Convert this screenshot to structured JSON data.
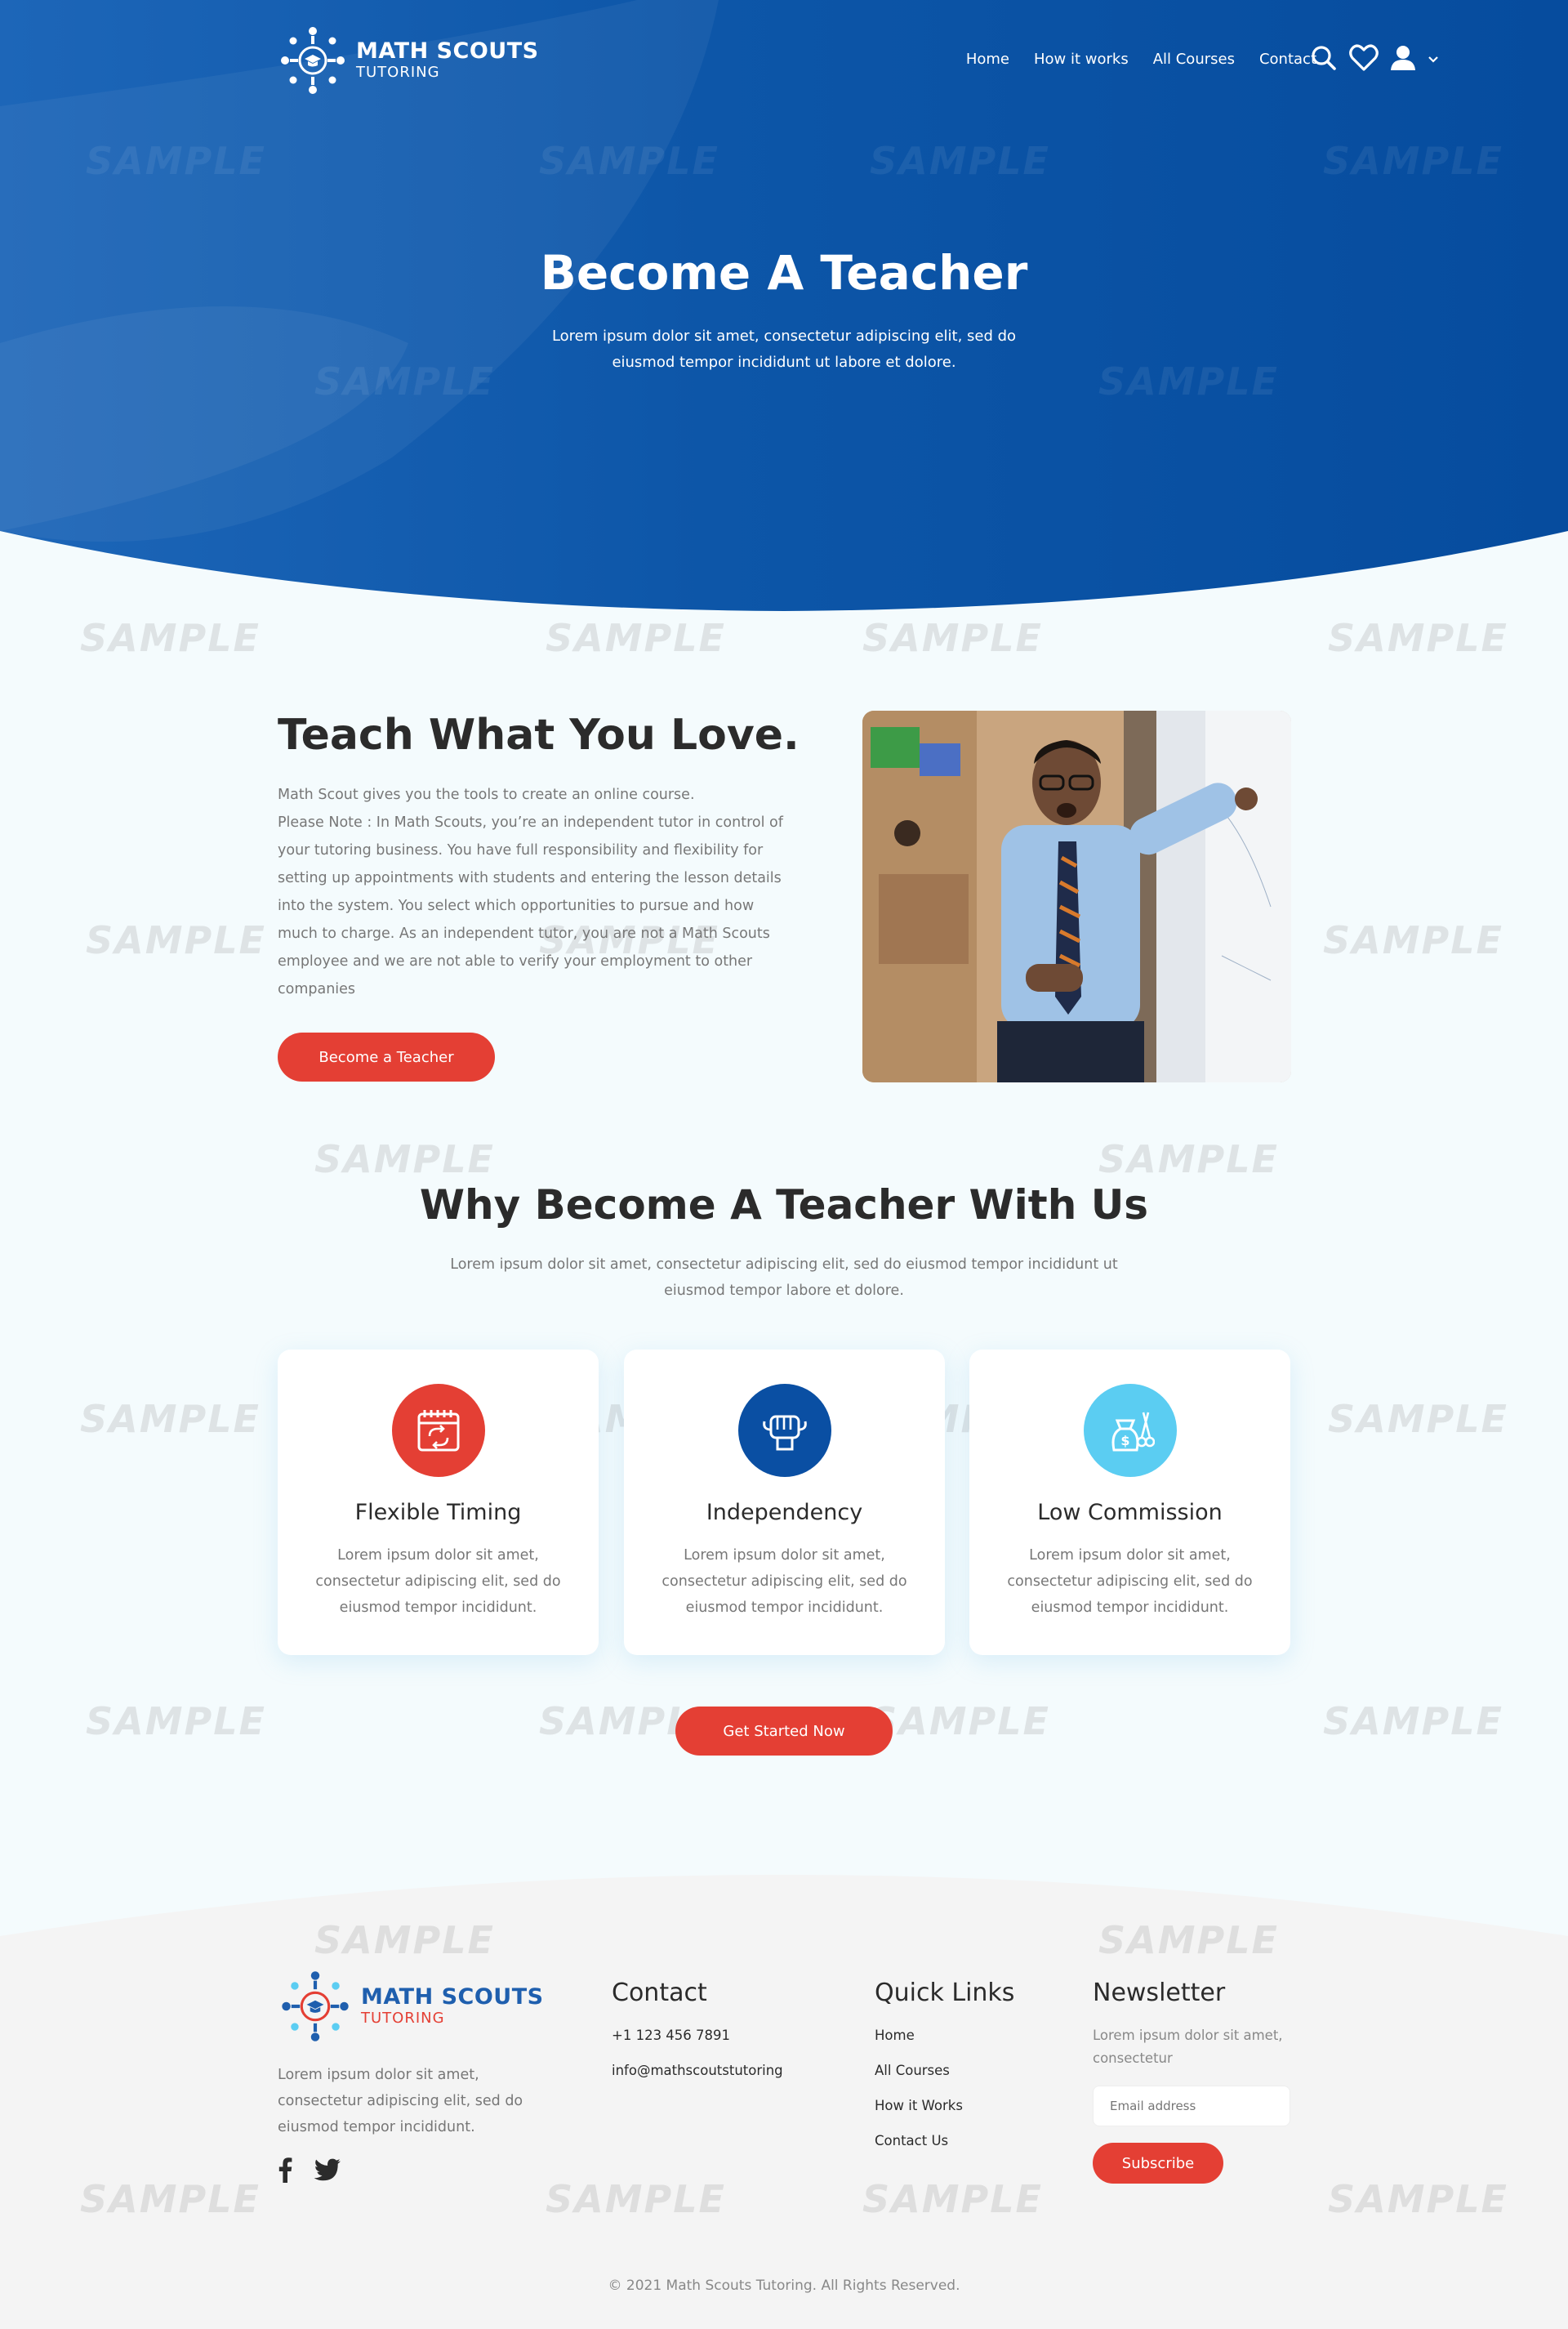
{
  "colors": {
    "primary_blue": "#0a4fa3",
    "hero_blue_light": "#2a74c4",
    "accent_red": "#e43f34",
    "accent_cyan": "#5bcdf2",
    "footer_bg": "#f4f4f4"
  },
  "brand": {
    "name": "MATH SCOUTS",
    "tagline": "TUTORING"
  },
  "nav": {
    "items": [
      {
        "label": "Home"
      },
      {
        "label": "How it works"
      },
      {
        "label": "All Courses"
      },
      {
        "label": "Contact"
      }
    ],
    "icons": [
      "search-icon",
      "heart-icon",
      "user-icon",
      "chevron-down-icon"
    ]
  },
  "hero": {
    "title": "Become A Teacher",
    "subtitle": "Lorem ipsum dolor sit amet, consectetur adipiscing elit, sed do eiusmod tempor incididunt ut labore et dolore."
  },
  "watermark": "SAMPLE",
  "teach": {
    "title": "Teach What You Love.",
    "paragraph_1": "Math Scout  gives you the tools to create an online course.",
    "paragraph_2": "Please Note : In Math Scouts, you’re an independent tutor in control of your tutoring business. You have full responsibility and flexibility for setting up appointments with students and entering the lesson details into the system. You select which opportunities to pursue and how much to charge. As an independent tutor, you are not a Math Scouts employee and we are not able to verify your employment to other companies",
    "button": "Become a Teacher"
  },
  "why": {
    "title": "Why Become A Teacher With Us",
    "subtitle": "Lorem ipsum dolor sit amet, consectetur adipiscing elit, sed do eiusmod tempor incididunt ut eiusmod tempor labore et dolore.",
    "cards": [
      {
        "icon": "calendar-icon",
        "title": "Flexible Timing",
        "text": "Lorem ipsum dolor sit amet, consectetur adipiscing elit, sed do eiusmod tempor incididunt."
      },
      {
        "icon": "fist-icon",
        "title": "Independency",
        "text": "Lorem ipsum dolor sit amet, consectetur adipiscing elit, sed do eiusmod tempor incididunt."
      },
      {
        "icon": "money-bag-icon",
        "title": "Low Commission",
        "text": "Lorem ipsum dolor sit amet, consectetur adipiscing elit, sed do eiusmod tempor incididunt."
      }
    ],
    "cta": "Get Started Now"
  },
  "footer": {
    "about": "Lorem ipsum dolor sit amet, consectetur adipiscing elit, sed do eiusmod tempor incididunt.",
    "social": [
      "facebook-icon",
      "twitter-icon"
    ],
    "contact": {
      "title": "Contact",
      "phone": "+1 123 456 7891",
      "email": "info@mathscoutstutoring"
    },
    "quick_links": {
      "title": "Quick Links",
      "items": [
        "Home",
        "All Courses",
        "How it Works",
        "Contact Us"
      ]
    },
    "newsletter": {
      "title": "Newsletter",
      "text": "Lorem ipsum dolor sit amet, consectetur",
      "placeholder": "Email address",
      "button": "Subscribe"
    },
    "copyright": "© 2021 Math Scouts Tutoring. All Rights Reserved."
  }
}
